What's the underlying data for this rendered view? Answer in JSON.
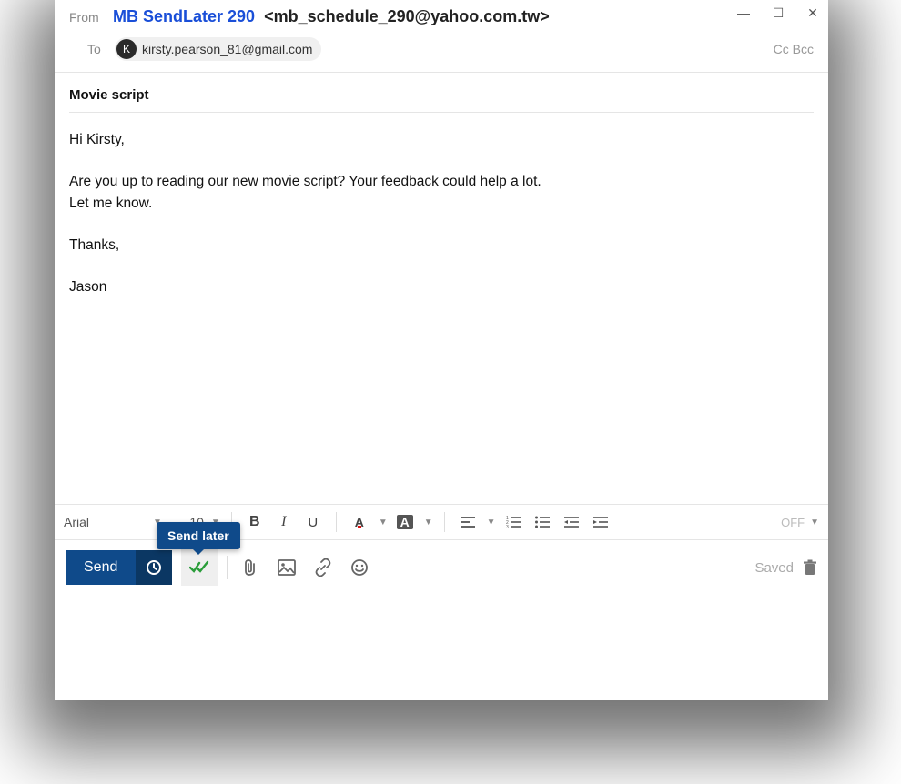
{
  "window": {
    "minimize": "—",
    "maximize": "☐",
    "close": "✕"
  },
  "from": {
    "label": "From",
    "name": "MB SendLater 290",
    "email": "<mb_schedule_290@yahoo.com.tw>"
  },
  "to": {
    "label": "To",
    "recipients": [
      {
        "initial": "K",
        "address": "kirsty.pearson_81@gmail.com"
      }
    ],
    "cc_label": "Cc",
    "bcc_label": "Bcc"
  },
  "subject": "Movie script",
  "body": {
    "l1": "Hi Kirsty,",
    "l2": "Are you up to reading our new movie script? Your feedback could help a lot.",
    "l3": "Let me know.",
    "l4": "Thanks,",
    "l5": "Jason"
  },
  "format": {
    "font_family": "Arial",
    "font_size": "10",
    "off_label": "OFF"
  },
  "actions": {
    "send_label": "Send",
    "send_later_tooltip": "Send later",
    "saved_label": "Saved"
  }
}
